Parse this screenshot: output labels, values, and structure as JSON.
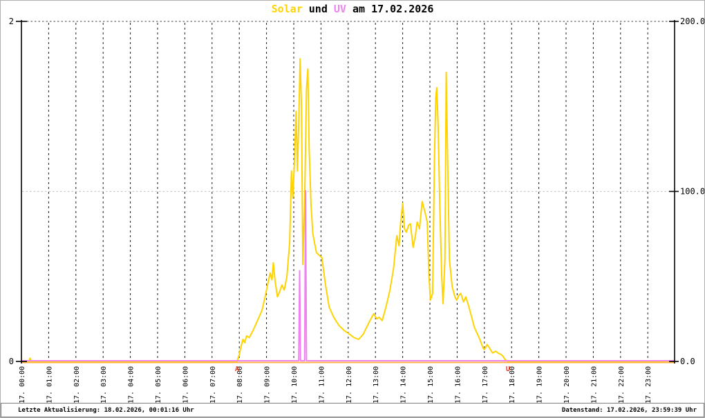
{
  "page": {
    "border_color": "#b0b0b0"
  },
  "title": {
    "part_solar": "Solar",
    "part_und": " und ",
    "part_uv": "UV",
    "part_date": " am 17.02.2026",
    "solar_color": "#ffd300",
    "uv_color": "#ee82ee",
    "text_color": "#000000"
  },
  "footer": {
    "left": "Letzte Aktualisierung: 18.02.2026, 00:01:16 Uhr",
    "right": "Datenstand: 17.02.2026, 23:59:39 Uhr"
  },
  "chart_data": {
    "type": "line",
    "title": "Solar und UV am 17.02.2026",
    "grid": "hourly vertical dashed, horizontal dotted at 100 and 200",
    "x_axis": {
      "tick_labels": [
        "17. 00:00",
        "17. 01:00",
        "17. 02:00",
        "17. 03:00",
        "17. 04:00",
        "17. 05:00",
        "17. 06:00",
        "17. 07:00",
        "17. 08:00",
        "17. 09:00",
        "17. 10:00",
        "17. 11:00",
        "17. 12:00",
        "17. 13:00",
        "17. 14:00",
        "17. 15:00",
        "17. 16:00",
        "17. 17:00",
        "17. 18:00",
        "17. 19:00",
        "17. 20:00",
        "17. 21:00",
        "17. 22:00",
        "17. 23:00"
      ]
    },
    "y_axis_left": {
      "name": "UV",
      "min": 0,
      "max": 2,
      "tick_labels": [
        "2",
        "0"
      ]
    },
    "y_axis_right": {
      "name": "Solar",
      "min": 0,
      "max": 200,
      "tick_labels": [
        "200.0",
        "100.0",
        "0.0"
      ]
    },
    "zero_line_color": "#ffb347",
    "gridline_200_color": "#666666",
    "gridline_100_color": "#c9c9c9",
    "gridline_hour_color": "#1a1a1a",
    "sun_markers": [
      {
        "label": "A",
        "time": "07:55",
        "color": "#e8391d"
      },
      {
        "label": "U",
        "time": "17:52",
        "color": "#e8391d"
      }
    ],
    "series": [
      {
        "name": "Solar",
        "color": "#ffd300",
        "axis": "right",
        "points": [
          [
            "00:00",
            0
          ],
          [
            "00:17",
            0
          ],
          [
            "00:19",
            2
          ],
          [
            "00:21",
            0
          ],
          [
            "01:00",
            0
          ],
          [
            "02:00",
            0
          ],
          [
            "03:00",
            0
          ],
          [
            "04:00",
            0
          ],
          [
            "05:00",
            0
          ],
          [
            "06:00",
            0
          ],
          [
            "07:00",
            0
          ],
          [
            "07:30",
            0
          ],
          [
            "07:55",
            0
          ],
          [
            "08:00",
            4
          ],
          [
            "08:05",
            10
          ],
          [
            "08:08",
            13
          ],
          [
            "08:12",
            11
          ],
          [
            "08:16",
            15
          ],
          [
            "08:22",
            14
          ],
          [
            "08:30",
            18
          ],
          [
            "08:40",
            24
          ],
          [
            "08:50",
            30
          ],
          [
            "08:57",
            38
          ],
          [
            "09:03",
            46
          ],
          [
            "09:08",
            52
          ],
          [
            "09:12",
            48
          ],
          [
            "09:15",
            58
          ],
          [
            "09:19",
            47
          ],
          [
            "09:24",
            38
          ],
          [
            "09:29",
            41
          ],
          [
            "09:34",
            45
          ],
          [
            "09:39",
            42
          ],
          [
            "09:45",
            50
          ],
          [
            "09:51",
            70
          ],
          [
            "09:55",
            112
          ],
          [
            "09:58",
            96
          ],
          [
            "10:02",
            120
          ],
          [
            "10:05",
            147
          ],
          [
            "10:08",
            112
          ],
          [
            "10:11",
            140
          ],
          [
            "10:14",
            178
          ],
          [
            "10:17",
            150
          ],
          [
            "10:20",
            57
          ],
          [
            "10:24",
            95
          ],
          [
            "10:28",
            160
          ],
          [
            "10:31",
            172
          ],
          [
            "10:34",
            125
          ],
          [
            "10:38",
            92
          ],
          [
            "10:42",
            75
          ],
          [
            "10:50",
            64
          ],
          [
            "11:02",
            61
          ],
          [
            "11:10",
            45
          ],
          [
            "11:18",
            32
          ],
          [
            "11:28",
            26
          ],
          [
            "11:40",
            21
          ],
          [
            "11:52",
            18
          ],
          [
            "12:03",
            16
          ],
          [
            "12:13",
            14
          ],
          [
            "12:23",
            13
          ],
          [
            "12:33",
            16
          ],
          [
            "12:46",
            23
          ],
          [
            "12:56",
            28
          ],
          [
            "13:03",
            25
          ],
          [
            "13:08",
            26
          ],
          [
            "13:15",
            24
          ],
          [
            "13:24",
            33
          ],
          [
            "13:32",
            42
          ],
          [
            "13:40",
            55
          ],
          [
            "13:47",
            74
          ],
          [
            "13:52",
            68
          ],
          [
            "13:55",
            80
          ],
          [
            "14:00",
            93
          ],
          [
            "14:04",
            78
          ],
          [
            "14:08",
            76
          ],
          [
            "14:13",
            80
          ],
          [
            "14:17",
            81
          ],
          [
            "14:23",
            67
          ],
          [
            "14:28",
            74
          ],
          [
            "14:32",
            82
          ],
          [
            "14:37",
            78
          ],
          [
            "14:43",
            94
          ],
          [
            "14:49",
            88
          ],
          [
            "14:54",
            82
          ],
          [
            "14:58",
            50
          ],
          [
            "15:01",
            36
          ],
          [
            "15:06",
            40
          ],
          [
            "15:10",
            120
          ],
          [
            "15:13",
            155
          ],
          [
            "15:15",
            161
          ],
          [
            "15:18",
            140
          ],
          [
            "15:22",
            90
          ],
          [
            "15:26",
            50
          ],
          [
            "15:29",
            34
          ],
          [
            "15:33",
            60
          ],
          [
            "15:36",
            170
          ],
          [
            "15:39",
            120
          ],
          [
            "15:43",
            60
          ],
          [
            "15:49",
            44
          ],
          [
            "15:55",
            38
          ],
          [
            "15:59",
            36
          ],
          [
            "16:04",
            39
          ],
          [
            "16:08",
            40
          ],
          [
            "16:14",
            35
          ],
          [
            "16:19",
            38
          ],
          [
            "16:25",
            33
          ],
          [
            "16:30",
            28
          ],
          [
            "16:38",
            20
          ],
          [
            "16:50",
            13
          ],
          [
            "16:57",
            8
          ],
          [
            "17:00",
            7
          ],
          [
            "17:06",
            10
          ],
          [
            "17:11",
            8
          ],
          [
            "17:18",
            5
          ],
          [
            "17:25",
            6
          ],
          [
            "17:30",
            5
          ],
          [
            "17:37",
            4
          ],
          [
            "17:41",
            3
          ],
          [
            "17:46",
            1
          ],
          [
            "17:52",
            0
          ],
          [
            "18:00",
            0
          ],
          [
            "19:00",
            0
          ],
          [
            "20:00",
            0
          ],
          [
            "21:00",
            0
          ],
          [
            "22:00",
            0
          ],
          [
            "23:00",
            0
          ],
          [
            "23:59",
            0
          ]
        ]
      },
      {
        "name": "UV",
        "color": "#ee82ee",
        "axis": "left",
        "points": [
          [
            "00:00",
            0
          ],
          [
            "10:11",
            0
          ],
          [
            "10:13",
            0.53
          ],
          [
            "10:15",
            0
          ],
          [
            "10:24",
            0
          ],
          [
            "10:26",
            1.0
          ],
          [
            "10:28",
            0
          ],
          [
            "23:59",
            0
          ]
        ]
      }
    ]
  }
}
